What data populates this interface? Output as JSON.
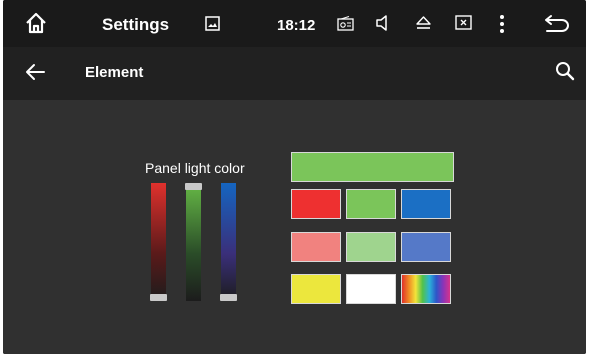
{
  "statusbar": {
    "title": "Settings",
    "time": "18:12",
    "icons": [
      "home-icon",
      "gallery-icon",
      "radio-icon",
      "volume-icon",
      "eject-icon",
      "close-window-icon",
      "more-vert-icon",
      "back-icon"
    ]
  },
  "appbar": {
    "title": "Element",
    "icons": [
      "arrow-back-icon",
      "search-icon"
    ]
  },
  "panel": {
    "label": "Panel light color",
    "sliders": [
      {
        "name": "red",
        "color": "#e53935",
        "value": 0.0
      },
      {
        "name": "green",
        "color": "#66bb6a",
        "value": 1.0
      },
      {
        "name": "blue",
        "color": "#1565c0",
        "value": 0.0
      }
    ]
  },
  "swatches": {
    "selected_color": "#7bc55a",
    "colors": [
      "#ee3030",
      "#7bc55a",
      "#1b6fc4",
      "#f1827f",
      "#9fd48e",
      "#5579c8",
      "#ece73d",
      "#ffffff",
      "rainbow"
    ]
  }
}
